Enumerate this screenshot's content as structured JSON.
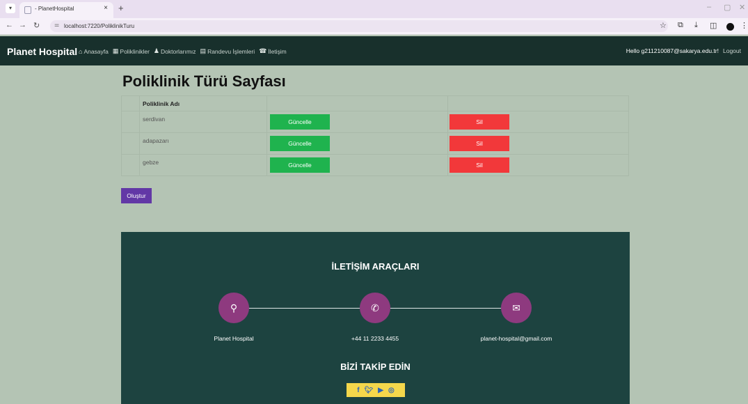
{
  "browser": {
    "tab_title": "- PlanetHospital",
    "tab_close": "×",
    "new_tab": "+",
    "url": "localhost:7220/PoliklinikTuru"
  },
  "navbar": {
    "brand": "Planet Hospital",
    "links": [
      {
        "label": "Anasayfa",
        "icon": "home-icon"
      },
      {
        "label": "Poliklinikler",
        "icon": "hospital-icon"
      },
      {
        "label": "Doktorlarımız",
        "icon": "user-icon"
      },
      {
        "label": "Randevu İşlemleri",
        "icon": "calendar-icon"
      },
      {
        "label": "İletişim",
        "icon": "phone-icon"
      }
    ],
    "hello": "Hello g211210087@sakarya.edu.tr!",
    "logout": "Logout"
  },
  "page": {
    "title": "Poliklinik Türü Sayfası",
    "column_header": "Poliklinik Adı",
    "rows": [
      {
        "name": "serdivan",
        "update_label": "Güncelle",
        "delete_label": "Sil"
      },
      {
        "name": "adapazarı",
        "update_label": "Güncelle",
        "delete_label": "Sil"
      },
      {
        "name": "gebze",
        "update_label": "Güncelle",
        "delete_label": "Sil"
      }
    ],
    "create_label": "Oluştur"
  },
  "footer": {
    "contact_title": "İLETİŞİM ARAÇLARI",
    "contacts": [
      {
        "label": "Planet Hospital",
        "icon": "location-icon"
      },
      {
        "label": "+44 11 2233 4455",
        "icon": "phone-icon"
      },
      {
        "label": "planet-hospital@gmail.com",
        "icon": "envelope-icon"
      }
    ],
    "follow_title": "BİZİ TAKİP EDİN",
    "social": [
      "facebook-icon",
      "twitter-icon",
      "youtube-icon",
      "instagram-icon"
    ]
  },
  "colors": {
    "navbar_bg": "#18302c",
    "page_bg": "#b4c4b4",
    "update_btn": "#1fb34e",
    "delete_btn": "#f2383a",
    "create_btn": "#6238a6",
    "footer_bg": "#1d4340",
    "contact_circle": "#8e3a7f",
    "social_box": "#f5d74b"
  }
}
